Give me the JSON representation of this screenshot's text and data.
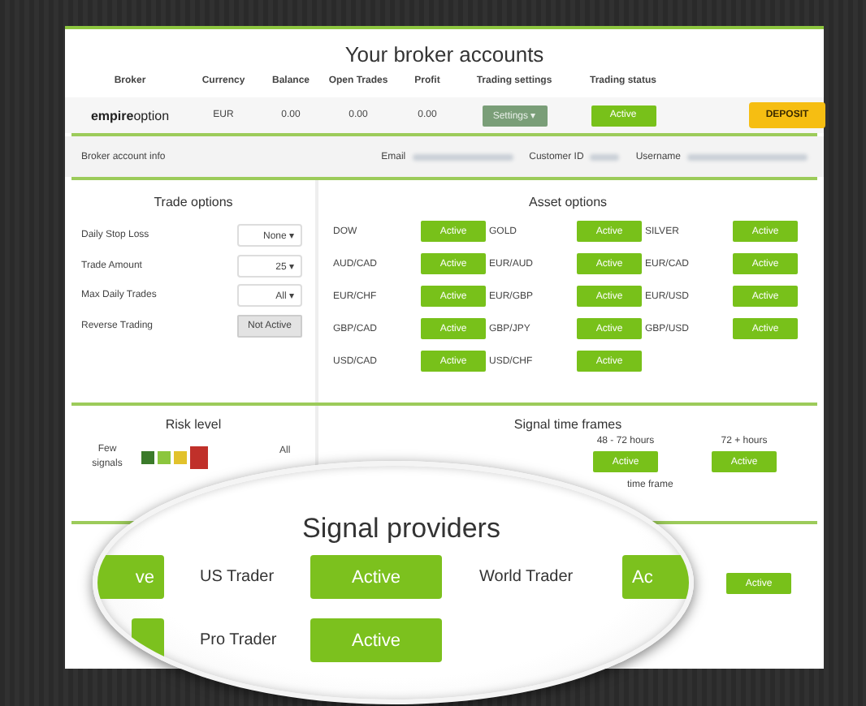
{
  "page_title": "Your broker accounts",
  "accounts_table": {
    "columns": [
      "Broker",
      "Currency",
      "Balance",
      "Open Trades",
      "Profit",
      "Trading settings",
      "Trading status"
    ],
    "rows": [
      {
        "broker": "**empire**option",
        "currency": "EUR",
        "balance": "0.00",
        "open_trades": "0.00",
        "profit": "0.00",
        "settings_button": "Settings ▾",
        "status_button": "Active",
        "active": true,
        "deposit_button": "DEPOSIT"
      }
    ]
  },
  "account_info": {
    "label": "Broker account info",
    "fields": [
      {
        "label": "Email"
      },
      {
        "label": "Customer ID"
      },
      {
        "label": "Username"
      }
    ]
  },
  "trade_options": {
    "title": "Trade options",
    "rows": [
      {
        "kind": "dropdown",
        "label": "Daily Stop Loss",
        "value": "None ▾"
      },
      {
        "kind": "dropdown",
        "label": "Trade Amount",
        "value": "25 ▾"
      },
      {
        "kind": "dropdown",
        "label": "Max Daily Trades",
        "value": "All ▾"
      },
      {
        "kind": "toggle",
        "label": "Reverse Trading",
        "value": "Not Active",
        "active": false
      }
    ]
  },
  "asset_options": {
    "title": "Asset options",
    "assets": [
      {
        "name": "DOW",
        "button": "Active",
        "active": true
      },
      {
        "name": "GOLD",
        "button": "Active",
        "active": true
      },
      {
        "name": "SILVER",
        "button": "Active",
        "active": true
      },
      {
        "name": "AUD/CAD",
        "button": "Active",
        "active": true
      },
      {
        "name": "EUR/AUD",
        "button": "Active",
        "active": true
      },
      {
        "name": "EUR/CAD",
        "button": "Active",
        "active": true
      },
      {
        "name": "EUR/CHF",
        "button": "Active",
        "active": true
      },
      {
        "name": "EUR/GBP",
        "button": "Active",
        "active": true
      },
      {
        "name": "EUR/USD",
        "button": "Active",
        "active": true
      },
      {
        "name": "GBP/CAD",
        "button": "Active",
        "active": true
      },
      {
        "name": "GBP/JPY",
        "button": "Active",
        "active": true
      },
      {
        "name": "GBP/USD",
        "button": "Active",
        "active": true
      },
      {
        "name": "USD/CAD",
        "button": "Active",
        "active": true
      },
      {
        "name": "USD/CHF",
        "button": "Active",
        "active": true
      }
    ]
  },
  "risk_level": {
    "title": "Risk level",
    "low_label": "Few signals",
    "high_label": "All",
    "segments": [
      {
        "color": "#3b7a2a",
        "selected": false
      },
      {
        "color": "#8cc63e",
        "selected": false
      },
      {
        "color": "#e2c22c",
        "selected": false
      },
      {
        "color": "#c0302a",
        "selected": true
      }
    ]
  },
  "signal_time_frames": {
    "title": "Signal time frames",
    "frames": [
      {
        "label": "48 - 72 hours",
        "button": "Active",
        "active": true
      },
      {
        "label": "72 + hours",
        "button": "Active",
        "active": true
      }
    ],
    "note": "time frame"
  },
  "signal_providers_behind": {
    "buttons": [
      {
        "label": "Active",
        "active": true
      }
    ]
  },
  "magnifier": {
    "title": "Signal providers",
    "providers": [
      {
        "kind": "edge",
        "button": "ve",
        "active": true
      },
      {
        "kind": "full",
        "name": "US Trader",
        "button": "Active",
        "active": true
      },
      {
        "kind": "full",
        "name": "World Trader",
        "button": "Ac",
        "active": true
      },
      {
        "kind": "edge",
        "active": true
      },
      {
        "kind": "full",
        "name": "Pro Trader",
        "button": "Active",
        "active": true
      }
    ]
  }
}
